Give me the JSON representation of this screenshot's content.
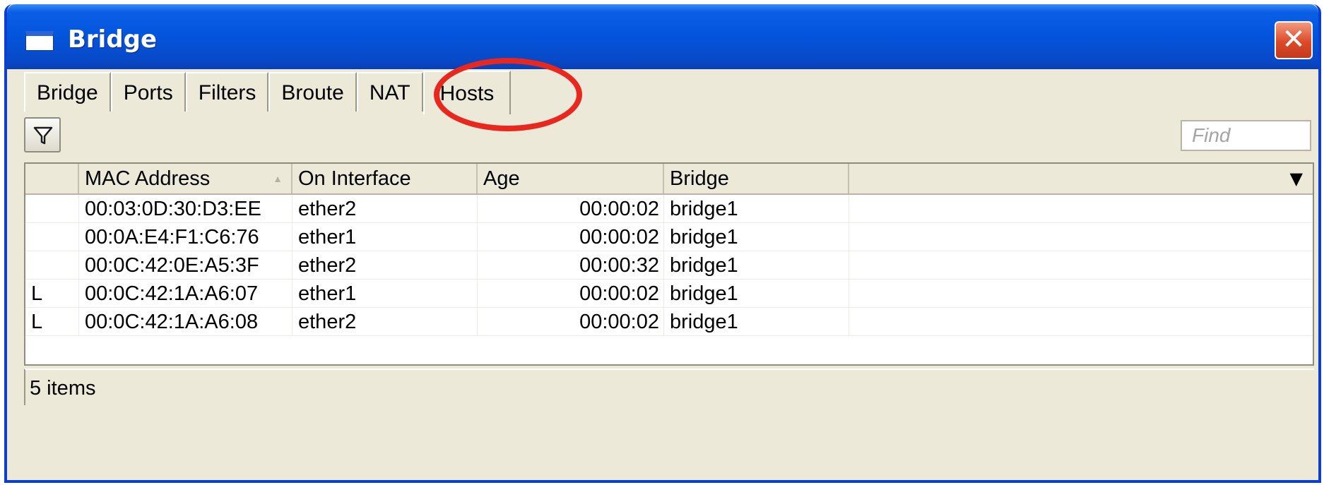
{
  "window": {
    "title": "Bridge",
    "close_glyph": "✕"
  },
  "tabs": [
    {
      "label": "Bridge",
      "active": false
    },
    {
      "label": "Ports",
      "active": false
    },
    {
      "label": "Filters",
      "active": false
    },
    {
      "label": "Broute",
      "active": false
    },
    {
      "label": "NAT",
      "active": false
    },
    {
      "label": "Hosts",
      "active": true
    }
  ],
  "toolbar": {
    "filter_icon": "funnel-icon",
    "find_placeholder": "Find"
  },
  "table": {
    "columns": [
      "",
      "MAC Address",
      "On Interface",
      "Age",
      "Bridge",
      ""
    ],
    "sort_column": "MAC Address",
    "rows": [
      {
        "flag": "",
        "mac": "00:03:0D:30:D3:EE",
        "interface": "ether2",
        "age": "00:00:02",
        "bridge": "bridge1"
      },
      {
        "flag": "",
        "mac": "00:0A:E4:F1:C6:76",
        "interface": "ether1",
        "age": "00:00:02",
        "bridge": "bridge1"
      },
      {
        "flag": "",
        "mac": "00:0C:42:0E:A5:3F",
        "interface": "ether2",
        "age": "00:00:32",
        "bridge": "bridge1"
      },
      {
        "flag": "L",
        "mac": "00:0C:42:1A:A6:07",
        "interface": "ether1",
        "age": "00:00:02",
        "bridge": "bridge1"
      },
      {
        "flag": "L",
        "mac": "00:0C:42:1A:A6:08",
        "interface": "ether2",
        "age": "00:00:02",
        "bridge": "bridge1"
      }
    ]
  },
  "status": {
    "items_text": "5 items"
  },
  "colors": {
    "titlebar": "#0454dc",
    "window_bg": "#ece9d8",
    "highlight": "#e8281e"
  }
}
